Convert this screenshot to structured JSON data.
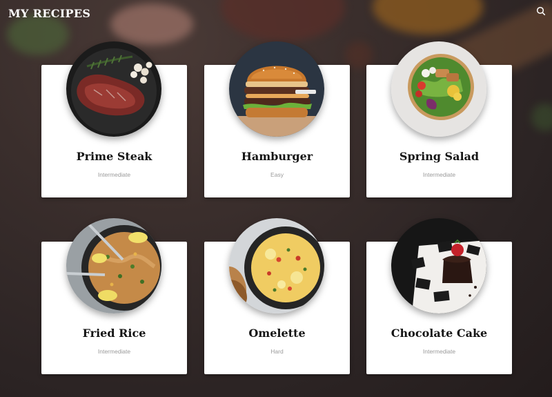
{
  "header": {
    "title": "MY RECIPES",
    "search_icon": "search-icon"
  },
  "recipes": [
    {
      "title": "Prime Steak",
      "level": "Intermediate",
      "image_icon": "steak-image"
    },
    {
      "title": "Hamburger",
      "level": "Easy",
      "image_icon": "hamburger-image"
    },
    {
      "title": "Spring Salad",
      "level": "Intermediate",
      "image_icon": "salad-image"
    },
    {
      "title": "Fried Rice",
      "level": "Intermediate",
      "image_icon": "fried-rice-image"
    },
    {
      "title": "Omelette",
      "level": "Hard",
      "image_icon": "omelette-image"
    },
    {
      "title": "Chocolate Cake",
      "level": "Intermediate",
      "image_icon": "chocolate-cake-image"
    }
  ],
  "colors": {
    "card_background": "#ffffff",
    "title_text": "#151515",
    "level_text": "#9a9a9a",
    "header_text": "#ffffff"
  }
}
